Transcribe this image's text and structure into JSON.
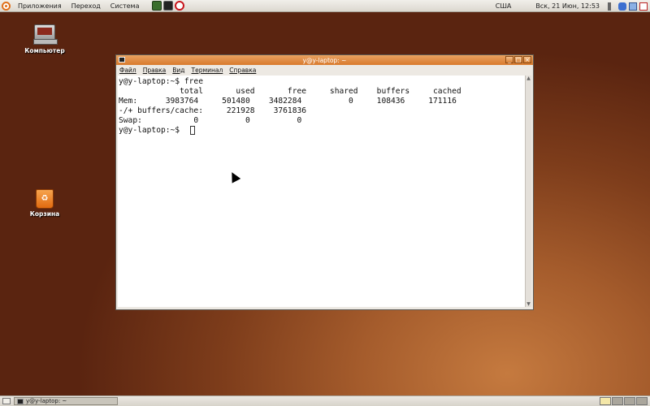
{
  "top_panel": {
    "menus": [
      "Приложения",
      "Переход",
      "Система"
    ],
    "keyboard_layout": "США",
    "clock": "Вск, 21 Июн, 12:53"
  },
  "desktop_icons": [
    {
      "label": "Компьютер",
      "icon": "computer-icon"
    },
    {
      "label": "Корзина",
      "icon": "trash-icon"
    }
  ],
  "terminal": {
    "title": "y@y-laptop: ~",
    "menu": [
      "Файл",
      "Правка",
      "Вид",
      "Терминал",
      "Справка"
    ],
    "lines": [
      "y@y-laptop:~$ free",
      "             total       used       free     shared    buffers     cached",
      "Mem:      3983764     501480    3482284          0     108436     171116",
      "-/+ buffers/cache:     221928    3761836",
      "Swap:           0          0          0",
      "y@y-laptop:~$ "
    ]
  },
  "taskbar": {
    "task_label": "y@y-laptop: ~",
    "workspaces": 4,
    "active_workspace": 1
  },
  "colors": {
    "title_orange": "#d97a2d",
    "desktop_brown": "#7e3d1b"
  }
}
